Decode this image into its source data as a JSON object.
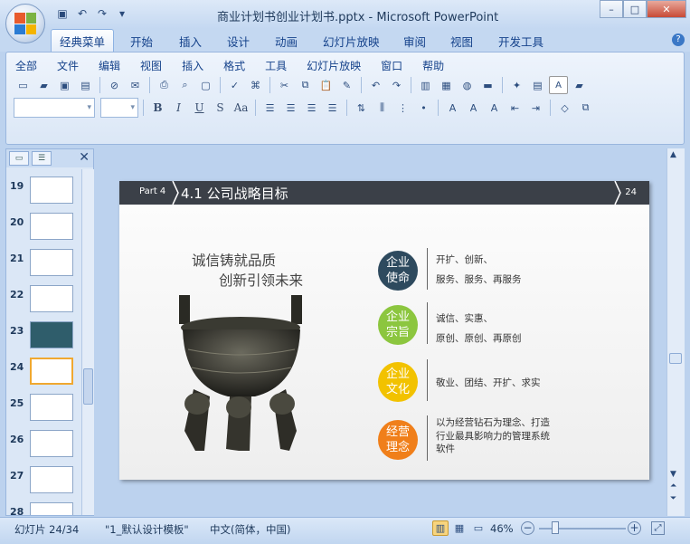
{
  "window": {
    "title": "商业计划书创业计划书.pptx - Microsoft PowerPoint"
  },
  "tabs": [
    "经典菜单",
    "开始",
    "插入",
    "设计",
    "动画",
    "幻灯片放映",
    "审阅",
    "视图",
    "开发工具"
  ],
  "menu": [
    "全部",
    "文件",
    "编辑",
    "视图",
    "插入",
    "格式",
    "工具",
    "幻灯片放映",
    "窗口",
    "帮助"
  ],
  "format_buttons": [
    "B",
    "I",
    "U",
    "S",
    "Aa"
  ],
  "thumbnails": [
    "19",
    "20",
    "21",
    "22",
    "23",
    "24",
    "25",
    "26",
    "27",
    "28"
  ],
  "slide": {
    "part_label": "Part 4",
    "title": "4.1 公司战略目标",
    "page_number": "24",
    "tagline_1": "诚信铸就品质",
    "tagline_2": "创新引领未来",
    "items": [
      {
        "label_1": "企业",
        "label_2": "使命",
        "color": "#2e4a5e",
        "line_1": "开扩、创新、",
        "line_2": "服务、服务、再服务"
      },
      {
        "label_1": "企业",
        "label_2": "宗旨",
        "color": "#8cc63f",
        "line_1": "诚信、实惠、",
        "line_2": "原创、原创、再原创"
      },
      {
        "label_1": "企业",
        "label_2": "文化",
        "color": "#f2c200",
        "line_1": "敬业、团结、开扩、求实",
        "line_2": ""
      },
      {
        "label_1": "经营",
        "label_2": "理念",
        "color": "#f07f1a",
        "line_1": "以为经营钻石为理念、打造",
        "line_2": "行业最具影响力的管理系统",
        "line_3": "软件"
      }
    ]
  },
  "status": {
    "slide_info": "幻灯片 24/34",
    "theme": "\"1_默认设计模板\"",
    "language": "中文(简体，中国)",
    "zoom": "46%"
  }
}
